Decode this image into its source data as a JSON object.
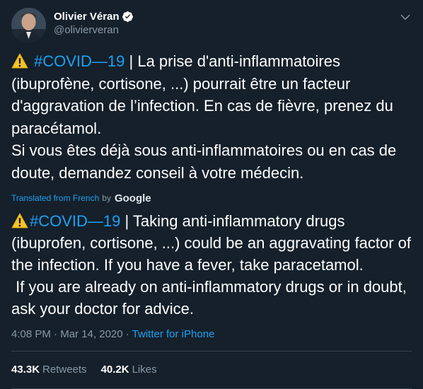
{
  "user": {
    "display_name": "Olivier Véran",
    "handle": "@olivierveran",
    "verified": true,
    "avatar_icon": "profile-photo"
  },
  "tweet": {
    "hashtag": "#COVID—19",
    "text_after_hashtag": " | La prise d'anti-inflammatoires (ibuprofène, cortisone, ...) pourrait être un facteur d'aggravation de l’infection. En cas de fièvre, prenez du paracétamol.\nSi vous êtes déjà sous anti-inflammatoires ou en cas de doute, demandez conseil à votre médecin.",
    "warning_icon": "warning-sign-emoji"
  },
  "translation": {
    "label": "Translated from French",
    "by": "by",
    "provider": "Google",
    "hashtag": "#COVID—19",
    "text_after_hashtag": " | Taking anti-inflammatory drugs (ibuprofen, cortisone, ...) could be an aggravating factor of the infection. If you have a fever, take paracetamol.\n If you are already on anti-inflammatory drugs or in doubt, ask your doctor for advice."
  },
  "meta": {
    "time": "4:08 PM",
    "separator": " · ",
    "date": "Mar 14, 2020",
    "source": "Twitter for iPhone"
  },
  "stats": {
    "retweets_count": "43.3K",
    "retweets_label": "Retweets",
    "likes_count": "40.2K",
    "likes_label": "Likes"
  },
  "colors": {
    "background": "#15202b",
    "accent": "#1da1f2",
    "secondary_text": "#8899a6",
    "divider": "#38444d"
  }
}
